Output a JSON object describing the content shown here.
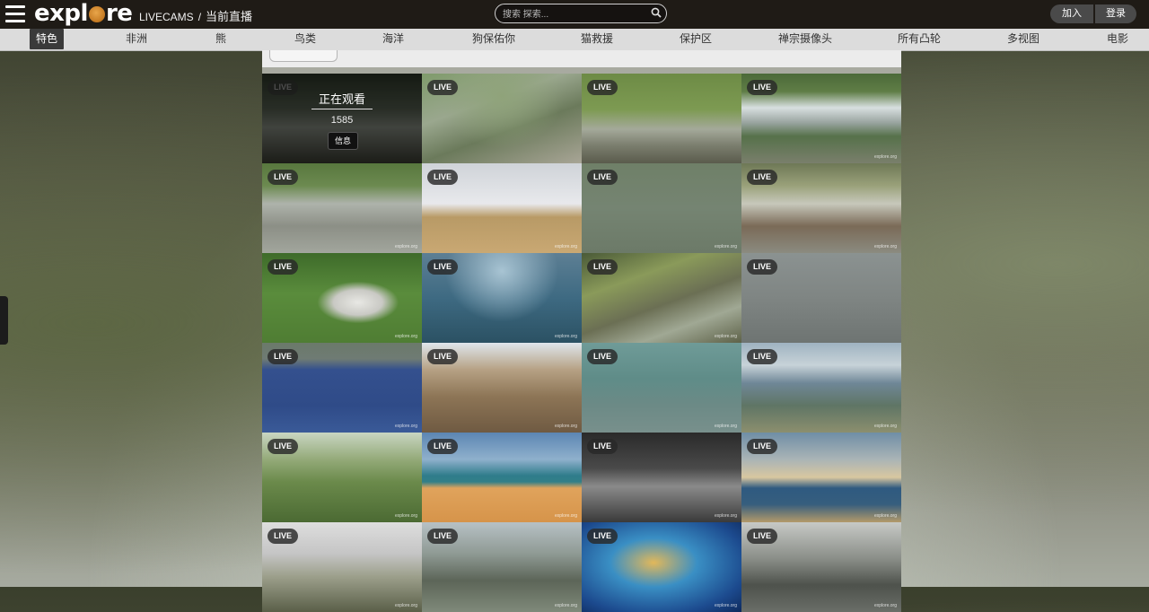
{
  "header": {
    "logo_text_left": "expl",
    "logo_text_right": "re",
    "breadcrumb_site": "LIVECAMS",
    "breadcrumb_sep": "/",
    "breadcrumb_current": "当前直播",
    "search_placeholder": "搜索 探索...",
    "join_label": "加入",
    "login_label": "登录"
  },
  "categories": [
    {
      "label": "特色",
      "active": true
    },
    {
      "label": "非洲"
    },
    {
      "label": "熊"
    },
    {
      "label": "鸟类"
    },
    {
      "label": "海洋"
    },
    {
      "label": "狗保佑你"
    },
    {
      "label": "猫救援"
    },
    {
      "label": "保护区"
    },
    {
      "label": "禅宗摄像头"
    },
    {
      "label": "所有凸轮"
    },
    {
      "label": "多视图"
    },
    {
      "label": "电影"
    }
  ],
  "grid": {
    "live_label": "LIVE",
    "watching_label": "正在观看",
    "watching_count": "1585",
    "info_label": "信息",
    "watermark": "explore.org",
    "tiles": [
      {
        "scene": "waterfall-dark"
      },
      {
        "scene": "pine-tree"
      },
      {
        "scene": "river-bear"
      },
      {
        "scene": "brooks-falls"
      },
      {
        "scene": "rapids"
      },
      {
        "scene": "kitten-room"
      },
      {
        "scene": "river-water"
      },
      {
        "scene": "osprey-nest"
      },
      {
        "scene": "panda"
      },
      {
        "scene": "aquarium-fish"
      },
      {
        "scene": "mossy-rocks"
      },
      {
        "scene": "fog"
      },
      {
        "scene": "blue-river"
      },
      {
        "scene": "dog-room"
      },
      {
        "scene": "underwater"
      },
      {
        "scene": "coast-cliff"
      },
      {
        "scene": "marsh"
      },
      {
        "scene": "beach"
      },
      {
        "scene": "night-feeder"
      },
      {
        "scene": "pier-sunset"
      },
      {
        "scene": "puppy-pen"
      },
      {
        "scene": "mountain-haze"
      },
      {
        "scene": "jellyfish"
      },
      {
        "scene": "cliff-gray"
      }
    ]
  },
  "colors": {
    "topbar": "#1f1b16",
    "nav_bg": "#dcdcdc",
    "active_tab": "#3a3a3a",
    "logo_accent": "#c57a22"
  }
}
